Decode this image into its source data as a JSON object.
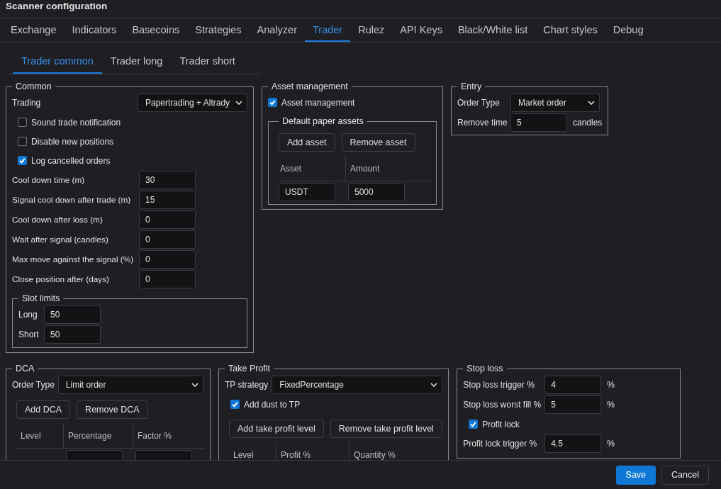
{
  "window": {
    "title": "Scanner configuration"
  },
  "tabs": [
    {
      "label": "Exchange",
      "selected": false
    },
    {
      "label": "Indicators",
      "selected": false
    },
    {
      "label": "Basecoins",
      "selected": false
    },
    {
      "label": "Strategies",
      "selected": false
    },
    {
      "label": "Analyzer",
      "selected": false
    },
    {
      "label": "Trader",
      "selected": true
    },
    {
      "label": "Rulez",
      "selected": false
    },
    {
      "label": "API Keys",
      "selected": false
    },
    {
      "label": "Black/White list",
      "selected": false
    },
    {
      "label": "Chart styles",
      "selected": false
    },
    {
      "label": "Debug",
      "selected": false
    }
  ],
  "subtabs": [
    {
      "label": "Trader common",
      "selected": true
    },
    {
      "label": "Trader long",
      "selected": false
    },
    {
      "label": "Trader short",
      "selected": false
    }
  ],
  "common": {
    "title": "Common",
    "trading": {
      "label": "Trading",
      "value": "Papertrading + Altrady"
    },
    "checkboxes": [
      {
        "label": "Sound trade notification",
        "checked": false
      },
      {
        "label": "Disable new positions",
        "checked": false
      },
      {
        "label": "Log cancelled orders",
        "checked": true
      }
    ],
    "fields": [
      {
        "label": "Cool down time (m)",
        "value": "30"
      },
      {
        "label": "Signal cool down after trade (m)",
        "value": "15"
      },
      {
        "label": "Cool down after loss (m)",
        "value": "0"
      },
      {
        "label": "Wait after signal (candles)",
        "value": "0"
      },
      {
        "label": "Max move against the signal (%)",
        "value": "0"
      },
      {
        "label": "Close position after (days)",
        "value": "0"
      }
    ],
    "slot_limits": {
      "title": "Slot limits",
      "fields": [
        {
          "label": "Long",
          "value": "50"
        },
        {
          "label": "Short",
          "value": "50"
        }
      ]
    }
  },
  "asset_management": {
    "title": "Asset management",
    "checkbox": {
      "label": "Asset management",
      "checked": true
    },
    "default_paper_assets": {
      "title": "Default paper assets",
      "buttons": [
        "Add asset",
        "Remove asset"
      ],
      "columns": [
        "Asset",
        "Amount"
      ],
      "rows": [
        [
          "USDT",
          "5000"
        ]
      ]
    }
  },
  "entry": {
    "title": "Entry",
    "order_type": {
      "label": "Order Type",
      "value": "Market order"
    },
    "remove_time": {
      "label": "Remove time",
      "value": "5",
      "unit": "candles"
    }
  },
  "dca": {
    "title": "DCA",
    "order_type": {
      "label": "Order Type",
      "value": "Limit order"
    },
    "buttons": [
      "Add DCA",
      "Remove DCA"
    ],
    "columns": [
      "Level",
      "Percentage",
      "Factor %"
    ]
  },
  "take_profit": {
    "title": "Take Profit",
    "strategy": {
      "label": "TP strategy",
      "value": "FixedPercentage"
    },
    "checkbox": {
      "label": "Add dust to TP",
      "checked": true
    },
    "buttons": [
      "Add take profit level",
      "Remove take profit level"
    ],
    "columns": [
      "Level",
      "Profit %",
      "Quantity %"
    ]
  },
  "stop_loss": {
    "title": "Stop loss",
    "items": [
      {
        "kind": "field",
        "label": "Stop loss trigger %",
        "value": "4",
        "unit": "%"
      },
      {
        "kind": "field",
        "label": "Stop loss worst fill %",
        "value": "5",
        "unit": "%"
      },
      {
        "kind": "checkbox",
        "label": "Profit lock",
        "checked": true
      },
      {
        "kind": "field",
        "label": "Profit lock trigger %",
        "value": "4.5",
        "unit": "%"
      }
    ]
  },
  "footer": {
    "buttons": [
      {
        "label": "Save",
        "kind": "primary"
      },
      {
        "label": "Cancel",
        "kind": "secondary"
      }
    ]
  }
}
